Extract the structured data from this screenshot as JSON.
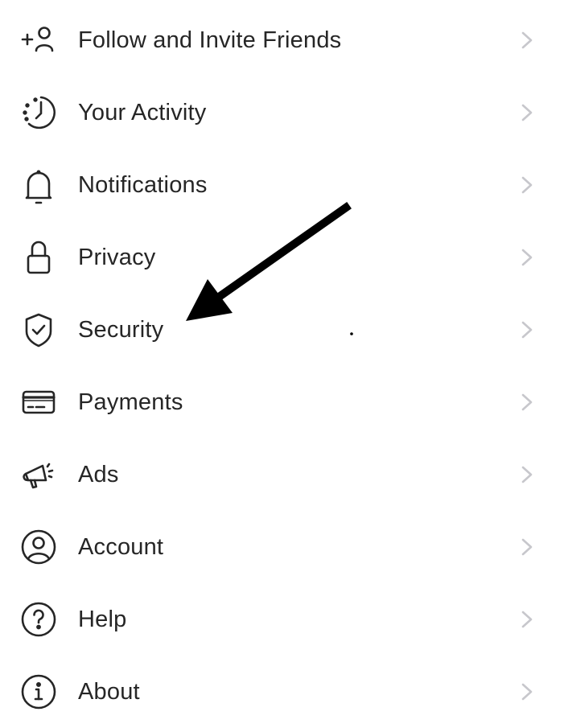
{
  "menu": {
    "items": [
      {
        "label": "Follow and Invite Friends",
        "icon": "add-person-icon"
      },
      {
        "label": "Your Activity",
        "icon": "activity-clock-icon"
      },
      {
        "label": "Notifications",
        "icon": "bell-icon"
      },
      {
        "label": "Privacy",
        "icon": "lock-icon"
      },
      {
        "label": "Security",
        "icon": "shield-check-icon"
      },
      {
        "label": "Payments",
        "icon": "credit-card-icon"
      },
      {
        "label": "Ads",
        "icon": "megaphone-icon"
      },
      {
        "label": "Account",
        "icon": "user-circle-icon"
      },
      {
        "label": "Help",
        "icon": "help-circle-icon"
      },
      {
        "label": "About",
        "icon": "info-circle-icon"
      }
    ],
    "chevron_icon": "chevron-right-icon"
  },
  "annotation": {
    "type": "arrow",
    "points_to": "Security"
  },
  "colors": {
    "text": "#262626",
    "icon": "#262626",
    "chevron": "#c7c7cc",
    "arrow": "#000000",
    "background": "#ffffff"
  }
}
